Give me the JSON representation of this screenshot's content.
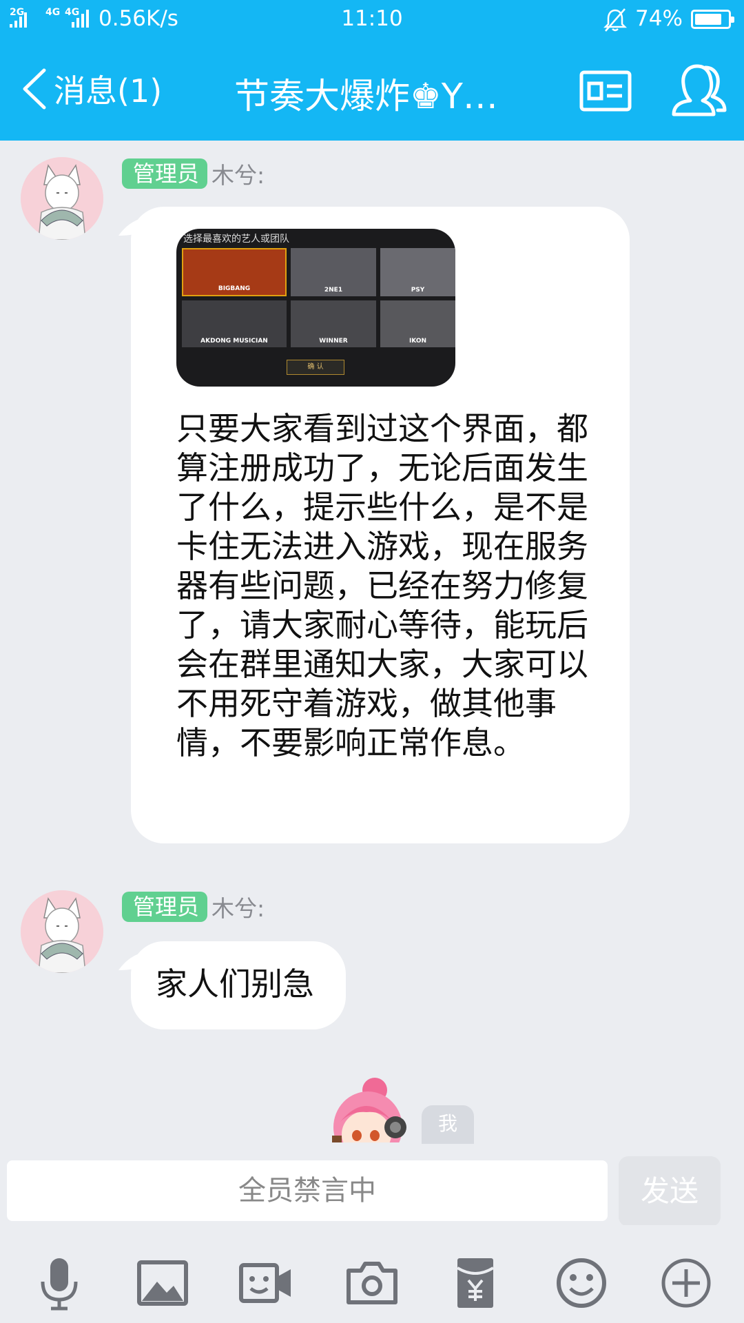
{
  "status_bar": {
    "sim1_label": "2G",
    "sim2_label": "4G",
    "sim2_label_b": "4G",
    "net_speed": "0.56K/s",
    "time": "11:10",
    "battery_percent": "74%",
    "battery_level": 0.74
  },
  "nav": {
    "back_label": "消息(1)",
    "title": "节奏大爆炸♚Y…"
  },
  "messages": [
    {
      "badge": "管理员",
      "sender": "木兮:",
      "image": {
        "title": "选择最喜欢的艺人或团队",
        "tiles": [
          "BIGBANG",
          "2NE1",
          "PSY",
          "AKDONG MUSICIAN",
          "WINNER",
          "IKON"
        ],
        "confirm": "确 认"
      },
      "text": "只要大家看到过这个界面，都算注册成功了，无论后面发生了什么，提示些什么，是不是卡住无法进入游戏，现在服务器有些问题，已经在努力修复了，请大家耐心等待，能玩后会在群里通知大家，大家可以不用死守着游戏，做其他事情，不要影响正常作息。"
    },
    {
      "badge": "管理员",
      "sender": "木兮:",
      "text": "家人们别急"
    }
  ],
  "me": {
    "tag": "我"
  },
  "input": {
    "placeholder": "全员禁言中",
    "send_label": "发送"
  },
  "toolbar": {
    "icons": [
      "microphone-icon",
      "image-icon",
      "video-call-icon",
      "camera-icon",
      "red-packet-icon",
      "emoji-icon",
      "plus-icon"
    ]
  },
  "colors": {
    "header_blue": "#14b7f4",
    "admin_badge_green": "#60d090",
    "chat_background": "#ebedf1"
  }
}
